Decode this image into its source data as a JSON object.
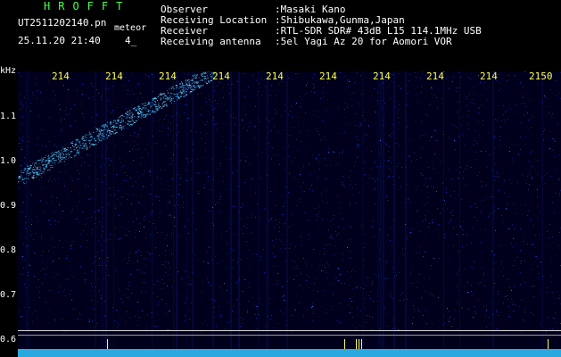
{
  "header": {
    "brand": "HROFFT",
    "file_name": "UT2511202140.pn",
    "file_ext": "meteor",
    "datetime": "25.11.20 21:40",
    "count": "4_"
  },
  "info": [
    {
      "label": "Observer",
      "value": ":Masaki Kano"
    },
    {
      "label": "Receiving Location",
      "value": ":Shibukawa,Gunma,Japan"
    },
    {
      "label": "Receiver",
      "value": ":RTL-SDR SDR# 43dB L15 114.1MHz USB"
    },
    {
      "label": "Receiving antenna",
      "value": ":5el Yagi Az 20 for Aomori VOR"
    }
  ],
  "spectrogram": {
    "y_unit": "kHz",
    "y_ticks": [
      "1.1",
      "1.0",
      "0.9",
      "0.8",
      "0.7",
      "0.6"
    ],
    "x_ticks": [
      "214",
      "214",
      "214",
      "214",
      "214",
      "214",
      "214",
      "214",
      "214",
      "2150"
    ],
    "colors": {
      "background": "#000000",
      "spectrum_bg": "#00001c",
      "trace": "#40c8ff",
      "noise": "#1030b0",
      "x_axis_text": "#ffff40",
      "brand": "#4cff4c",
      "baseline": "#2aa9e0"
    }
  }
}
